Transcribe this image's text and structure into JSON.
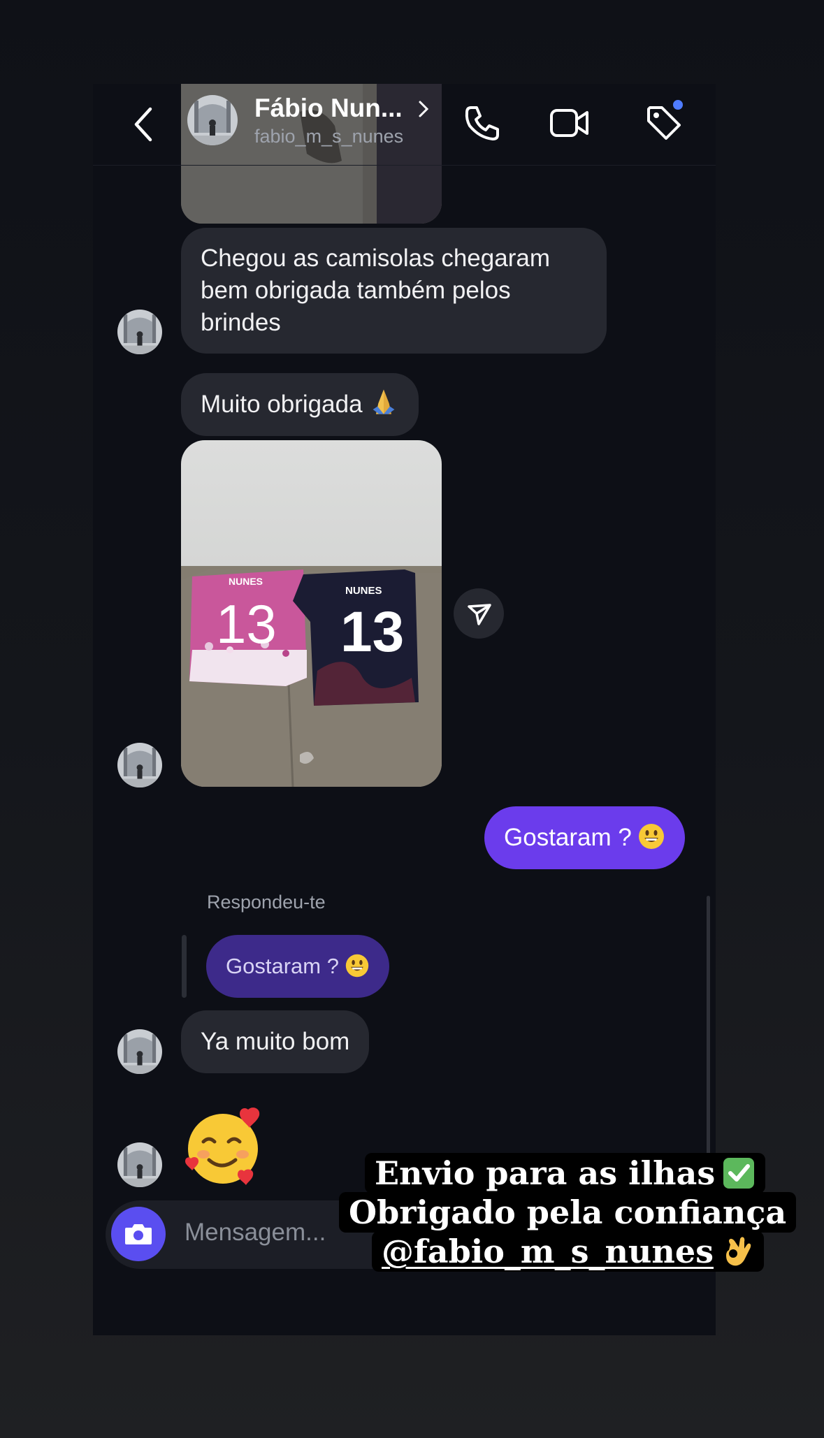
{
  "header": {
    "name": "Fábio Nun...",
    "username": "fabio_m_s_nunes"
  },
  "messages": {
    "msg1": "Chegou as camisolas chegaram bem obrigada também pelos brindes",
    "msg2": "Muito obrigada",
    "msg3_out": "Gostaram ?",
    "reply_label": "Respondeu-te",
    "reply_quote": "Gostaram ?",
    "msg4": "Ya muito bom"
  },
  "photo": {
    "shirt_name_left": "NUNES",
    "shirt_number_left": "13",
    "shirt_name_right": "NUNES",
    "shirt_number_right": "13"
  },
  "composer": {
    "placeholder": "Mensagem..."
  },
  "story_caption": {
    "line1": "Envio para as ilhas",
    "line2": "Obrigado pela confiança",
    "line3": "@fabio_m_s_nunes"
  },
  "colors": {
    "outgoing_bubble": "#6b3cec",
    "incoming_bubble": "#262830",
    "reply_bubble": "#3d2a8a",
    "camera_button": "#5a4ef0",
    "notification_dot": "#4f7cff"
  }
}
